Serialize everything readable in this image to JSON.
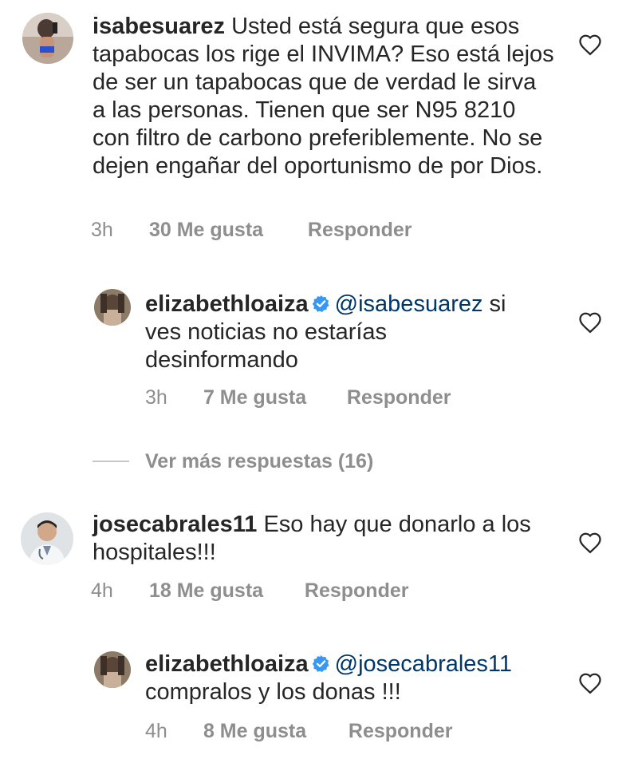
{
  "comments": [
    {
      "username": "isabesuarez",
      "text": "Usted está segura que esos tapabocas los rige el INVIMA? Eso está lejos de ser un tapabocas que de verdad le sirva a las personas. Tienen que ser N95 8210 con filtro de carbono preferiblemente. No se dejen engañar del oportunismo de por Dios.",
      "time": "3h",
      "likes": "30 Me gusta",
      "reply": "Responder"
    },
    {
      "username": "elizabethloaiza",
      "mention": "@isabesuarez",
      "text": "si ves noticias no estarías desinformando",
      "time": "3h",
      "likes": "7 Me gusta",
      "reply": "Responder"
    },
    {
      "username": "josecabrales11",
      "text": "Eso hay que donarlo a los hospitales!!!",
      "time": "4h",
      "likes": "18 Me gusta",
      "reply": "Responder"
    },
    {
      "username": "elizabethloaiza",
      "mention": "@josecabrales11",
      "text": "compralos y los donas !!!",
      "time": "4h",
      "likes": "8 Me gusta",
      "reply": "Responder"
    }
  ],
  "view_more": "Ver más respuestas (16)",
  "colors": {
    "text": "#262626",
    "meta": "#8e8e8e",
    "mention": "#00376b",
    "verified": "#3897f0"
  },
  "icons": {
    "like": "heart-outline-icon",
    "verified": "verified-badge-icon"
  }
}
